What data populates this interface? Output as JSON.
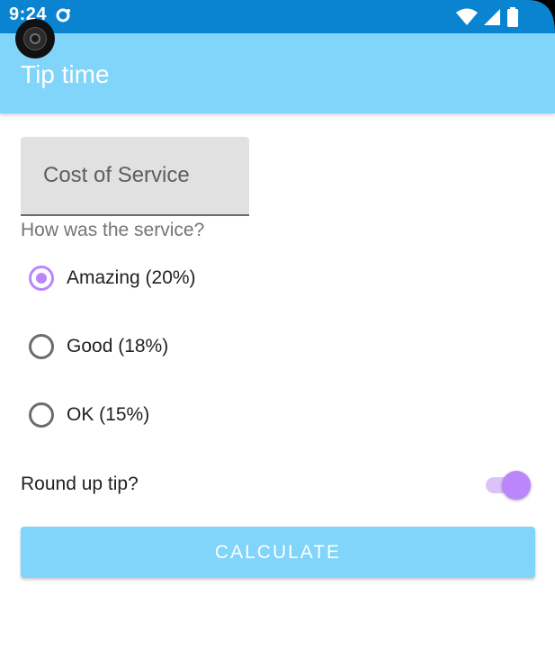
{
  "status_bar": {
    "time": "9:24",
    "icons": [
      "notification-icon",
      "wifi-icon",
      "signal-icon",
      "battery-icon"
    ]
  },
  "app_bar": {
    "title": "Tip time",
    "color": "#81d4fa"
  },
  "form": {
    "cost_placeholder": "Cost of Service",
    "cost_value": "",
    "question": "How was the service?",
    "options": [
      {
        "label": "Amazing (20%)",
        "checked": true
      },
      {
        "label": "Good (18%)",
        "checked": false
      },
      {
        "label": "OK (15%)",
        "checked": false
      }
    ],
    "round_up_label": "Round up tip?",
    "round_up_on": true,
    "calculate_label": "CALCULATE"
  },
  "colors": {
    "status_bar": "#0a84d0",
    "accent": "#bb86fc",
    "button": "#81d4fa"
  }
}
